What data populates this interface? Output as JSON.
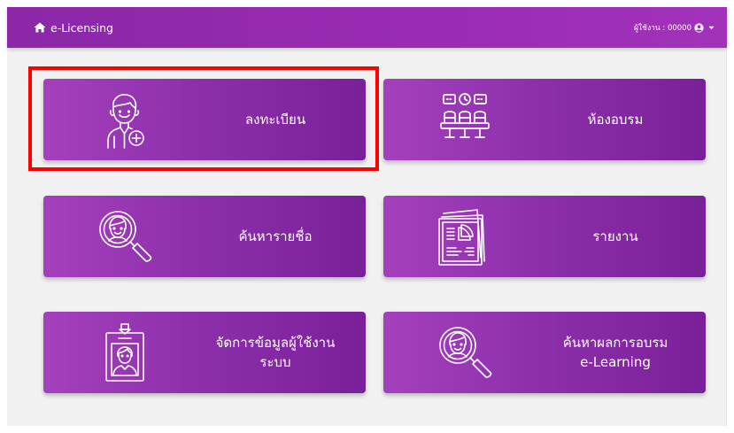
{
  "navbar": {
    "brand_label": "e-Licensing",
    "brand_icon": "home-icon",
    "user_label": "ผู้ใช้งาน : 00000",
    "user_icon": "user-circle-icon",
    "caret_icon": "caret-down-icon"
  },
  "menu": {
    "register": {
      "label": "ลงทะเบียน",
      "icon": "person-add-icon"
    },
    "classroom": {
      "label": "ห้องอบรม",
      "icon": "classroom-seats-icon"
    },
    "search_name": {
      "label": "ค้นหารายชื่อ",
      "icon": "person-search-icon"
    },
    "report": {
      "label": "รายงาน",
      "icon": "report-document-icon"
    },
    "manage_users": {
      "label_line1": "จัดการข้อมูลผู้ใช้งาน",
      "label_line2": "ระบบ",
      "icon": "id-badge-icon"
    },
    "search_results": {
      "label_line1": "ค้นหาผลการอบรม",
      "label_line2": "e-Learning",
      "icon": "person-search-icon"
    }
  },
  "colors": {
    "navbar": "#9a2cb3",
    "card_start": "#a540bd",
    "card_end": "#7a1f9a",
    "background": "#f1f1f1",
    "highlight": "#ff0000"
  }
}
